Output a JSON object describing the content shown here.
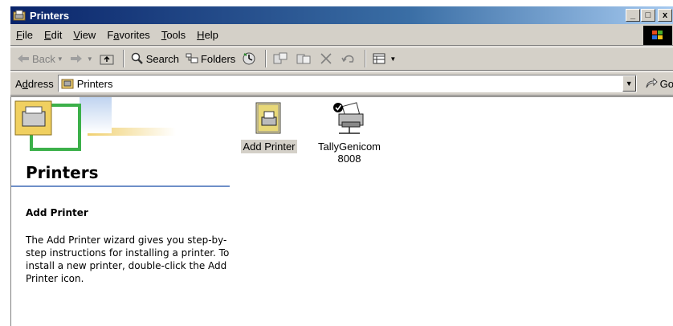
{
  "window": {
    "title": "Printers",
    "buttons": {
      "minimize": "_",
      "maximize": "□",
      "close": "x"
    }
  },
  "menu": [
    {
      "pre": "",
      "u": "F",
      "post": "ile"
    },
    {
      "pre": "",
      "u": "E",
      "post": "dit"
    },
    {
      "pre": "",
      "u": "V",
      "post": "iew"
    },
    {
      "pre": "F",
      "u": "a",
      "post": "vorites"
    },
    {
      "pre": "",
      "u": "T",
      "post": "ools"
    },
    {
      "pre": "",
      "u": "H",
      "post": "elp"
    }
  ],
  "toolbar": {
    "back": "Back",
    "search": "Search",
    "folders": "Folders"
  },
  "address": {
    "label_pre": "A",
    "label_u": "d",
    "label_post": "dress",
    "value": "Printers",
    "go": "Go"
  },
  "panel": {
    "title": "Printers",
    "heading": "Add Printer",
    "description": "The Add Printer wizard gives you step-by-step instructions for installing a printer. To install a new printer, double-click the Add Printer icon."
  },
  "items": [
    {
      "label": "Add Printer",
      "icon": "add-printer-icon"
    },
    {
      "label": "TallyGenicom 8008",
      "icon": "network-printer-icon"
    }
  ]
}
